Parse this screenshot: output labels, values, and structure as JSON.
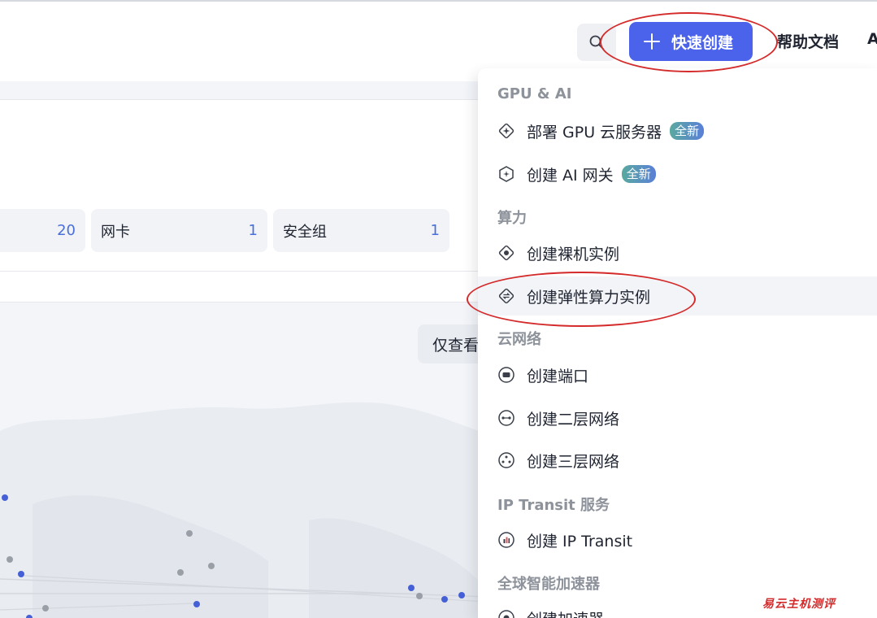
{
  "topbar": {
    "search_icon": "search-icon",
    "quick_create_label": "快速创建",
    "help_docs_label": "帮助文档",
    "cut_text": "A"
  },
  "stats": [
    {
      "label": "",
      "value": "20"
    },
    {
      "label": "网卡",
      "value": "1"
    },
    {
      "label": "安全组",
      "value": "1"
    }
  ],
  "view_only_label": "仅查看",
  "dropdown": {
    "groups": [
      {
        "title": "GPU & AI",
        "items": [
          {
            "label": "部署 GPU 云服务器",
            "badge": "全新",
            "icon": "gpu-diamond-icon"
          },
          {
            "label": "创建 AI 网关",
            "badge": "全新",
            "icon": "ai-gateway-icon"
          }
        ]
      },
      {
        "title": "算力",
        "items": [
          {
            "label": "创建裸机实例",
            "icon": "bare-metal-icon"
          },
          {
            "label": "创建弹性算力实例",
            "icon": "elastic-compute-icon"
          }
        ]
      },
      {
        "title": "云网络",
        "items": [
          {
            "label": "创建端口",
            "icon": "port-icon"
          },
          {
            "label": "创建二层网络",
            "icon": "layer2-network-icon"
          },
          {
            "label": "创建三层网络",
            "icon": "layer3-network-icon"
          }
        ]
      },
      {
        "title": "IP Transit 服务",
        "items": [
          {
            "label": "创建 IP Transit",
            "icon": "ip-transit-icon"
          }
        ]
      },
      {
        "title": "全球智能加速器",
        "items": [
          {
            "label": "创建加速器",
            "icon": "accelerator-icon"
          }
        ]
      }
    ]
  },
  "watermark": "易云主机测评",
  "colors": {
    "accent": "#4a63ea",
    "annotation": "#d42a2a",
    "link_number": "#4a6fd8"
  }
}
